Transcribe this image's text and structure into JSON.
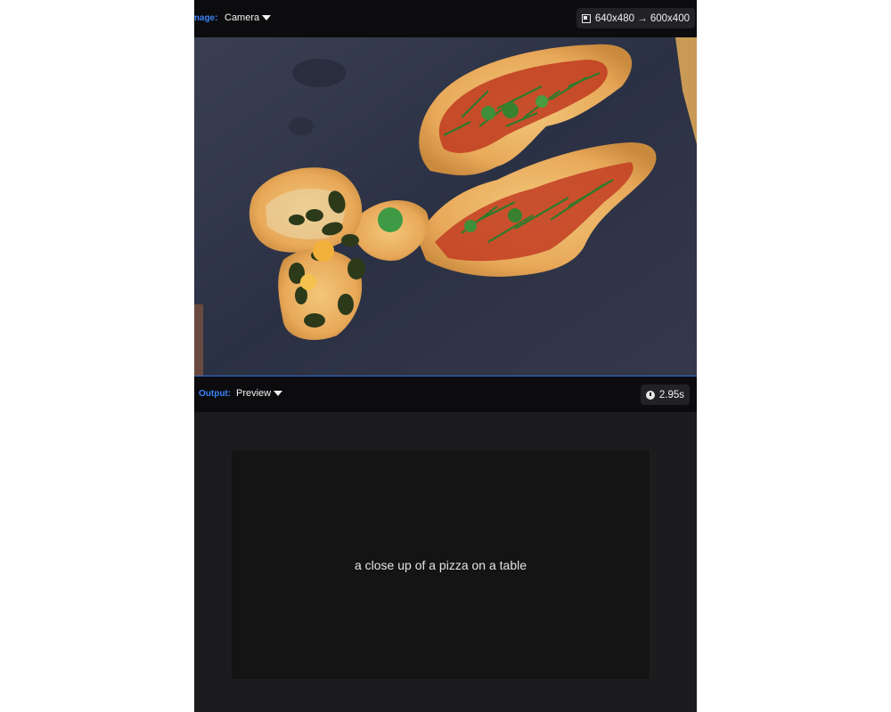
{
  "input_bar": {
    "label": "mage:",
    "source_value": "Camera",
    "resolution": "640x480 → 600x400"
  },
  "output_bar": {
    "label": "Output:",
    "mode_value": "Preview",
    "elapsed": "2.95s"
  },
  "output": {
    "caption": "a close up of a pizza on a table"
  },
  "colors": {
    "accent": "#3b82f6",
    "background": "#1c1c1e",
    "bar": "#0c0c0e",
    "caption_box": "#141414"
  },
  "icons": {
    "resolution": "resize-icon",
    "time": "clock-icon",
    "dropdown": "caret-down-icon"
  }
}
